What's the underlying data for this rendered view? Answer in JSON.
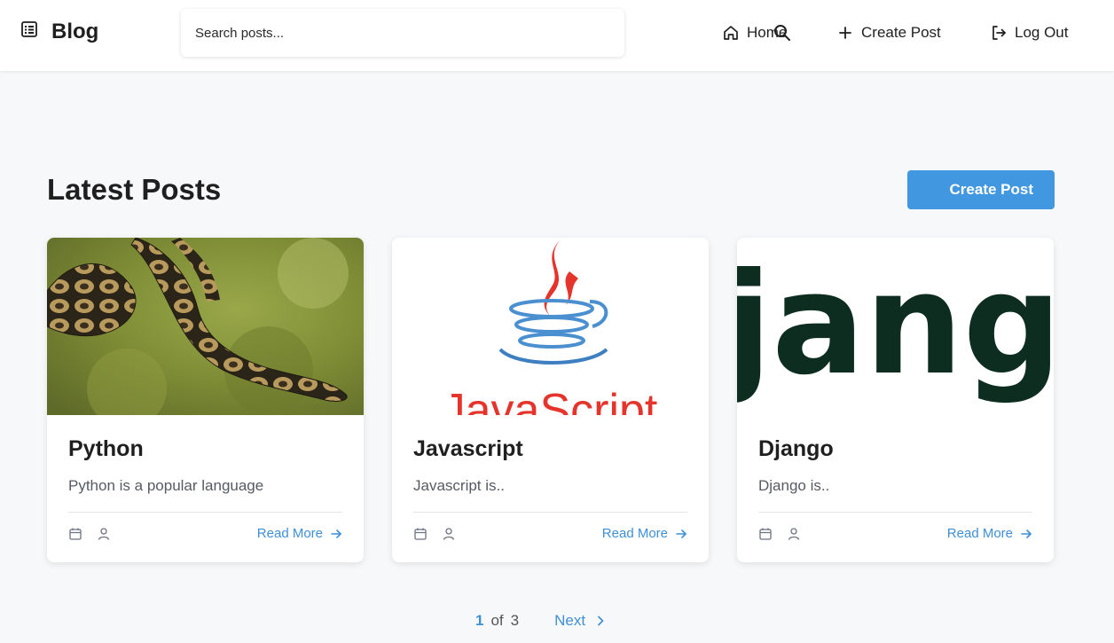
{
  "header": {
    "brand": "Blog",
    "search_placeholder": "Search posts...",
    "nav": [
      {
        "label": "Home",
        "icon": "home-icon"
      },
      {
        "label": "Create Post",
        "icon": "plus-icon"
      },
      {
        "label": "Log Out",
        "icon": "logout-icon"
      }
    ]
  },
  "main": {
    "title": "Latest Posts",
    "create_button": "Create Post",
    "posts": [
      {
        "title": "Python",
        "description": "Python is a popular language",
        "read_more": "Read More",
        "image": "python-snake-image"
      },
      {
        "title": "Javascript",
        "description": "Javascript is..",
        "read_more": "Read More",
        "image": "javascript-logo-image"
      },
      {
        "title": "Django",
        "description": "Django is..",
        "read_more": "Read More",
        "image": "django-logo-image"
      }
    ],
    "image_text": {
      "javascript": "JavaScript",
      "django": "jang"
    }
  },
  "pagination": {
    "current": "1",
    "of": "of",
    "total": "3",
    "next": "Next"
  },
  "colors": {
    "accent": "#4197e0",
    "link": "#3f8fd6",
    "background": "#f7f8fa",
    "django_green": "#0c2d20"
  }
}
